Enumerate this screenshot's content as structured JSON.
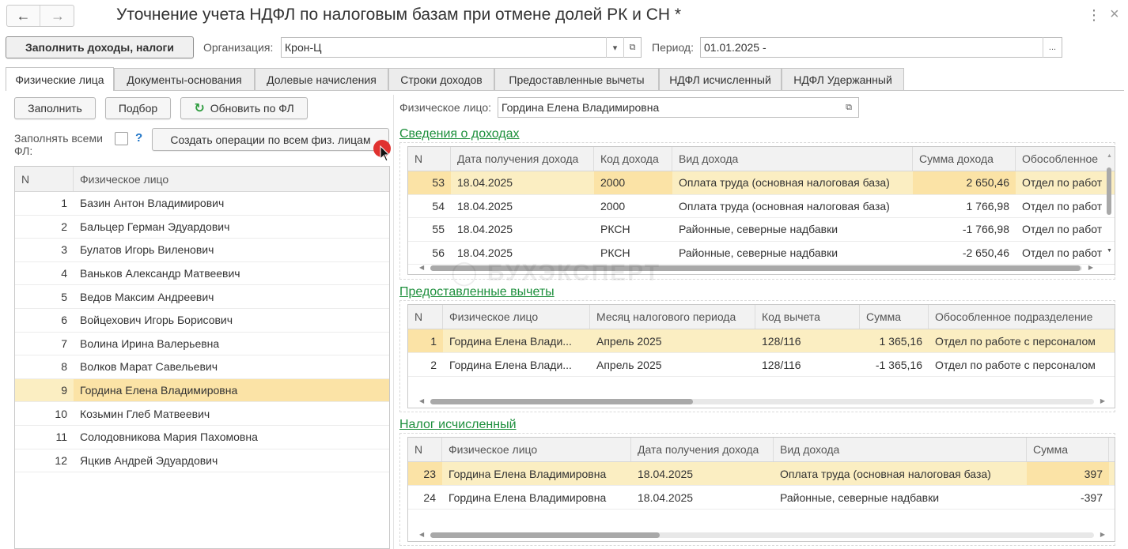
{
  "window": {
    "title": "Уточнение учета НДФЛ по налоговым базам при отмене долей РК и СН *"
  },
  "toolbar": {
    "fill_button": "Заполнить доходы, налоги",
    "org_label": "Организация:",
    "org_value": "Крон-Ц",
    "period_label": "Период:",
    "period_value": "01.01.2025 -",
    "period_select": "..."
  },
  "tabs": [
    {
      "label": "Физические лица"
    },
    {
      "label": "Документы-основания"
    },
    {
      "label": "Долевые начисления"
    },
    {
      "label": "Строки доходов"
    },
    {
      "label": "Предоставленные вычеты"
    },
    {
      "label": "НДФЛ исчисленный"
    },
    {
      "label": "НДФЛ Удержанный"
    }
  ],
  "left": {
    "fill_btn": "Заполнить",
    "pick_btn": "Подбор",
    "refresh_btn": "Обновить по ФЛ",
    "fill_all_label_1": "Заполнять всеми",
    "fill_all_label_2": "ФЛ:",
    "help": "?",
    "create_ops_btn": "Создать операции по всем физ. лицам",
    "table": {
      "headers": [
        "N",
        "Физическое лицо"
      ],
      "rows": [
        {
          "n": "1",
          "name": "Базин Антон Владимирович"
        },
        {
          "n": "2",
          "name": "Бальцер Герман Эдуардович"
        },
        {
          "n": "3",
          "name": "Булатов Игорь Виленович"
        },
        {
          "n": "4",
          "name": "Ваньков Александр Матвеевич"
        },
        {
          "n": "5",
          "name": "Ведов Максим Андреевич"
        },
        {
          "n": "6",
          "name": "Войцехович Игорь Борисович"
        },
        {
          "n": "7",
          "name": "Волина Ирина Валерьевна"
        },
        {
          "n": "8",
          "name": "Волков Марат Савельевич"
        },
        {
          "n": "9",
          "name": "Гордина Елена Владимировна"
        },
        {
          "n": "10",
          "name": "Козьмин Глеб Матвеевич"
        },
        {
          "n": "11",
          "name": "Солодовникова Мария Пахомовна"
        },
        {
          "n": "12",
          "name": "Яцкив Андрей Эдуардович"
        }
      ]
    }
  },
  "right": {
    "person_label": "Физическое лицо:",
    "person_value": "Гордина Елена Владимировна",
    "income": {
      "title": "Сведения о доходах",
      "headers": [
        "N",
        "Дата получения дохода",
        "Код дохода",
        "Вид дохода",
        "Сумма дохода",
        "Обособленное"
      ],
      "rows": [
        {
          "n": "53",
          "date": "18.04.2025",
          "code": "2000",
          "kind": "Оплата труда (основная налоговая база)",
          "sum": "2 650,46",
          "dept": "Отдел по работ"
        },
        {
          "n": "54",
          "date": "18.04.2025",
          "code": "2000",
          "kind": "Оплата труда (основная налоговая база)",
          "sum": "1 766,98",
          "dept": "Отдел по работ"
        },
        {
          "n": "55",
          "date": "18.04.2025",
          "code": "РКСН",
          "kind": "Районные, северные надбавки",
          "sum": "-1 766,98",
          "dept": "Отдел по работ"
        },
        {
          "n": "56",
          "date": "18.04.2025",
          "code": "РКСН",
          "kind": "Районные, северные надбавки",
          "sum": "-2 650,46",
          "dept": "Отдел по работ"
        }
      ]
    },
    "deductions": {
      "title": "Предоставленные вычеты",
      "headers": [
        "N",
        "Физическое лицо",
        "Месяц налогового периода",
        "Код вычета",
        "Сумма",
        "Обособленное подразделение"
      ],
      "rows": [
        {
          "n": "1",
          "person": "Гордина Елена Влади...",
          "month": "Апрель 2025",
          "code": "128/116",
          "sum": "1 365,16",
          "dept": "Отдел по работе с персоналом"
        },
        {
          "n": "2",
          "person": "Гордина Елена Влади...",
          "month": "Апрель 2025",
          "code": "128/116",
          "sum": "-1 365,16",
          "dept": "Отдел по работе с персоналом"
        }
      ]
    },
    "tax": {
      "title": "Налог исчисленный",
      "headers": [
        "N",
        "Физическое лицо",
        "Дата получения дохода",
        "Вид дохода",
        "Сумма"
      ],
      "rows": [
        {
          "n": "23",
          "person": "Гордина Елена Владимировна",
          "date": "18.04.2025",
          "kind": "Оплата труда (основная налоговая база)",
          "sum": "397"
        },
        {
          "n": "24",
          "person": "Гордина Елена Владимировна",
          "date": "18.04.2025",
          "kind": "Районные, северные надбавки",
          "sum": "-397"
        }
      ]
    }
  },
  "watermark": "БУХЭКСПЕРТ",
  "colors": {
    "accent_green": "#1d8f3c",
    "selected_row": "#fbeec2",
    "selected_cell": "#fbe3a6",
    "cursor_dot": "#e0312f"
  }
}
